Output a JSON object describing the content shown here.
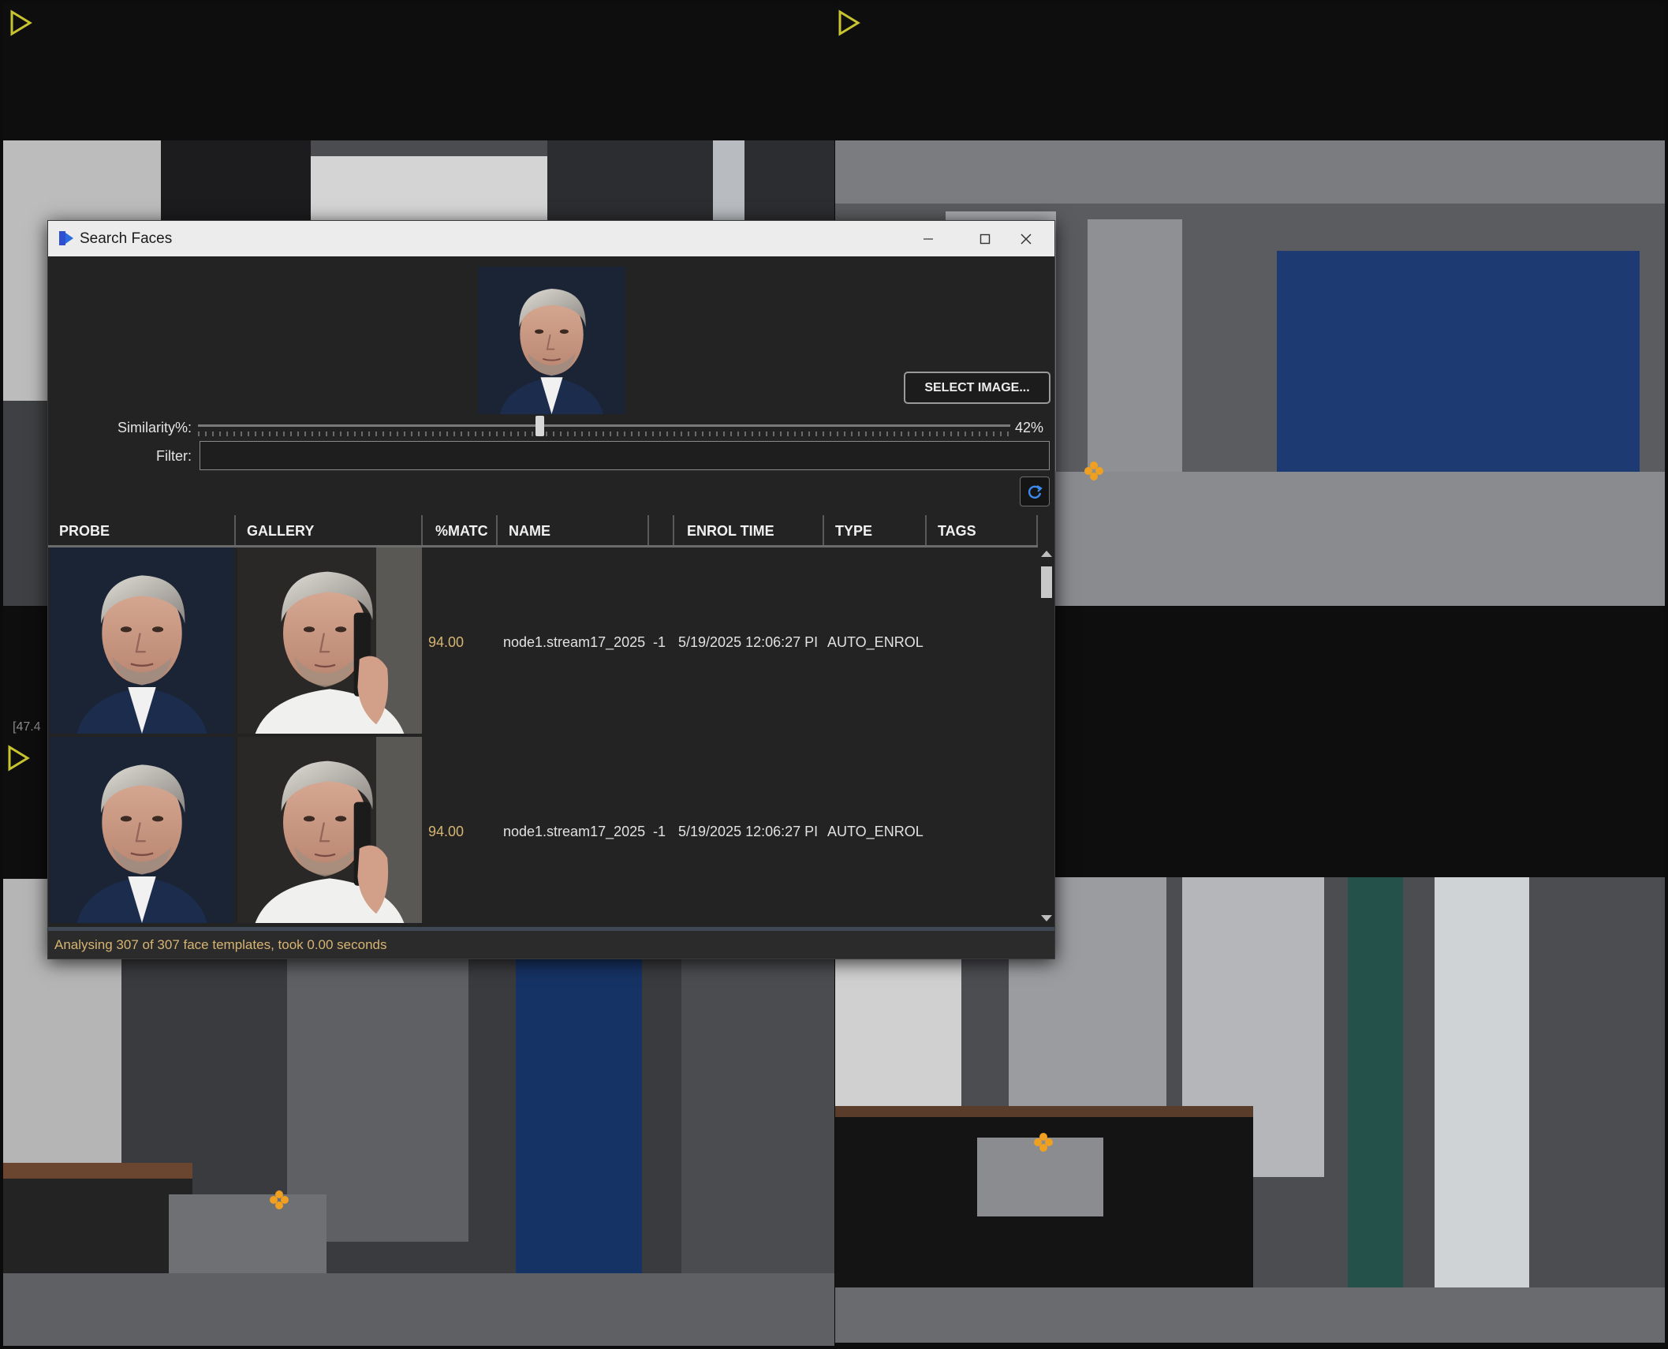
{
  "background": {
    "tile_overlay_text": "[47.4"
  },
  "dialog": {
    "title": "Search Faces",
    "window_controls": {
      "minimize": "—",
      "maximize": "☐",
      "close": "✕"
    },
    "select_image_label": "SELECT IMAGE...",
    "similarity": {
      "label": "Similarity%:",
      "value_text": "42%",
      "value_fraction": 0.42
    },
    "filter": {
      "label": "Filter:",
      "value": ""
    },
    "columns": [
      "PROBE",
      "GALLERY",
      "%MATC",
      "NAME",
      "",
      "ENROL TIME",
      "TYPE",
      "TAGS"
    ],
    "rows": [
      {
        "match": "94.00",
        "name": "node1.stream17_2025",
        "num": "-1",
        "enrol_time": "5/19/2025 12:06:27 PI",
        "type": "AUTO_ENROL",
        "tags": ""
      },
      {
        "match": "94.00",
        "name": "node1.stream17_2025",
        "num": "-1",
        "enrol_time": "5/19/2025 12:06:27 PI",
        "type": "AUTO_ENROL",
        "tags": ""
      }
    ],
    "status": "Analysing 307 of 307 face templates, took 0.00 seconds"
  },
  "colors": {
    "accent_yellow": "#c8c430",
    "match_text": "#d7b472",
    "app_icon_blue": "#2f4fd1"
  },
  "icons": [
    "play-icon",
    "app-logo-icon",
    "minimize-icon",
    "maximize-icon",
    "close-icon",
    "refresh-icon",
    "turnstile-marker-icon"
  ]
}
